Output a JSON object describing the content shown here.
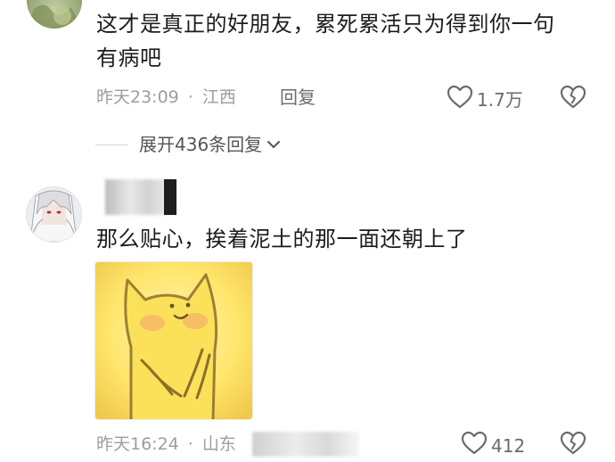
{
  "comments": [
    {
      "text_line1": "这才是真正的好朋友，累死累活只为得到你一句",
      "text_line2": "有病吧",
      "time": "昨天23:09",
      "separator": "·",
      "location": "江西",
      "reply_label": "回复",
      "likes": "1.7万"
    },
    {
      "text_line1": "那么贴心，挨着泥土的那一面还朝上了",
      "time": "昨天16:24",
      "separator": "·",
      "location": "山东",
      "likes": "412"
    }
  ],
  "expand_replies": {
    "label": "展开436条回复"
  },
  "icons": {
    "like": "heart-outline-icon",
    "dislike": "broken-heart-icon",
    "expand": "chevron-down-icon"
  },
  "colors": {
    "text": "#1c1c1c",
    "meta": "#9d9d9d",
    "sticker_yellow": "#ffe56b"
  }
}
